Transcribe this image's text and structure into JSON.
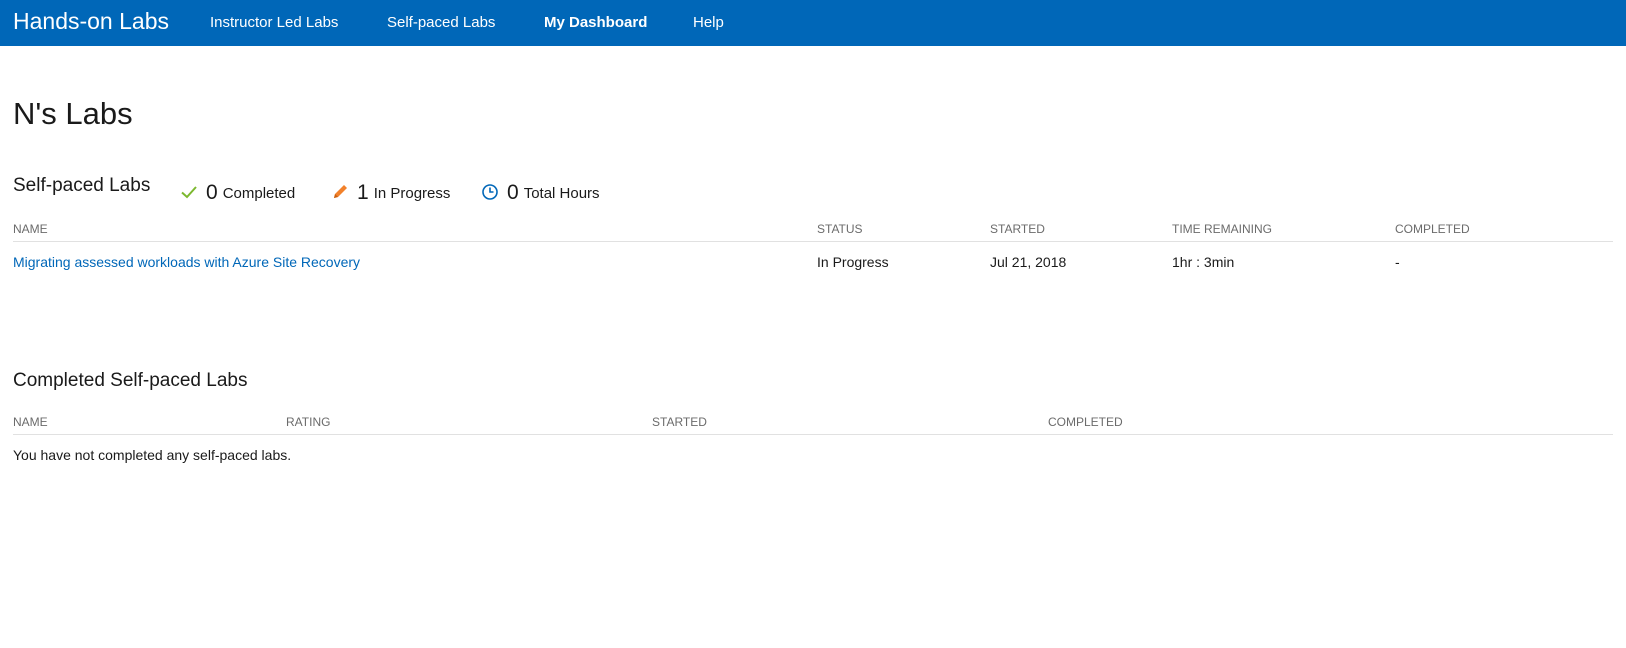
{
  "header": {
    "brand": "Hands-on Labs",
    "nav": [
      {
        "label": "Instructor Led Labs",
        "active": false
      },
      {
        "label": "Self-paced Labs",
        "active": false
      },
      {
        "label": "My Dashboard",
        "active": true
      },
      {
        "label": "Help",
        "active": false
      }
    ],
    "bg_color": "#0067b8"
  },
  "page": {
    "title": "N's Labs"
  },
  "self_paced": {
    "title": "Self-paced Labs",
    "stats": [
      {
        "icon": "check-icon",
        "value": "0",
        "label": "Completed",
        "color": "#7cb82f"
      },
      {
        "icon": "pencil-icon",
        "value": "1",
        "label": "In Progress",
        "color": "#f2812b"
      },
      {
        "icon": "clock-icon",
        "value": "0",
        "label": "Total Hours",
        "color": "#0067b8"
      }
    ],
    "columns": [
      "NAME",
      "STATUS",
      "STARTED",
      "TIME REMAINING",
      "COMPLETED"
    ],
    "rows": [
      {
        "name": "Migrating assessed workloads with Azure Site Recovery",
        "status": "In Progress",
        "started": "Jul 21, 2018",
        "time_remaining": "1hr : 3min",
        "completed": "-"
      }
    ]
  },
  "completed": {
    "title": "Completed Self-paced Labs",
    "columns": [
      "NAME",
      "RATING",
      "STARTED",
      "COMPLETED"
    ],
    "empty_message": "You have not completed any self-paced labs."
  }
}
